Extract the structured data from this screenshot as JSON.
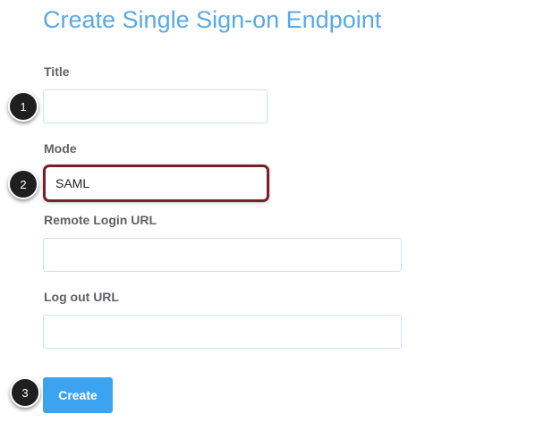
{
  "page": {
    "title": "Create Single Sign-on Endpoint"
  },
  "form": {
    "title_label": "Title",
    "title_value": "",
    "mode_label": "Mode",
    "mode_value": "SAML",
    "remote_login_url_label": "Remote Login URL",
    "remote_login_url_value": "",
    "logout_url_label": "Log out URL",
    "logout_url_value": "",
    "create_label": "Create"
  },
  "steps": [
    "1",
    "2",
    "3"
  ],
  "colors": {
    "title": "#58a9e6",
    "button": "#3ba3f0",
    "highlight_border": "#7b1f2a",
    "badge": "#1f1f1f"
  }
}
